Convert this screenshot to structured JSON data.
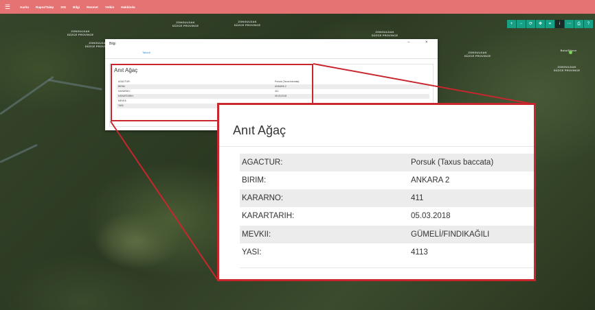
{
  "navbar": {
    "items": [
      "Harita",
      "Rapor/Talep",
      "SIG",
      "Bilgi",
      "Resmet",
      "Yetkin",
      "Hakkinda"
    ]
  },
  "map_tools": {
    "icons": [
      "plus-icon",
      "minus-icon",
      "refresh-icon",
      "crosshair-icon",
      "grid-icon",
      "info-icon",
      "ruler-icon",
      "print-icon",
      "help-icon"
    ],
    "glyphs": [
      "+",
      "−",
      "⟳",
      "✥",
      "⌗",
      "i",
      "⋯",
      "⎙",
      "?"
    ]
  },
  "map_labels": {
    "label1": "ZONGULDAK\nDÜZCE PROVINCE",
    "label2": "ZONGULDAK\nDÜZCE PROVINCE",
    "label3": "ZONGULDAK\nDÜZCE PROVINCE",
    "label4": "ZONGULDAK\nDÜZCE PROVINCE",
    "label5": "ZONGULDAK\nDÜZCE PROVINCE",
    "label6": "ZONGULDAK\nDÜZCE PROVINCE",
    "label7": "Bolu/Düzce",
    "label8": "ZONGULDAK\nDÜZCE PROVINCE"
  },
  "dialog": {
    "title": "Bilgi",
    "minimize": "−",
    "close": "×",
    "tab": "Tablo6",
    "card_title": "Anıt Ağaç",
    "rows": [
      {
        "k": "AGACTUR:",
        "v": "Porsuk (Taxus baccata)"
      },
      {
        "k": "BIRIM:",
        "v": "ANKARA 2"
      },
      {
        "k": "KARARNO:",
        "v": "411"
      },
      {
        "k": "KARARTARIH:",
        "v": "05.03.2018"
      },
      {
        "k": "MEVKII:",
        "v": ""
      },
      {
        "k": "YASI:",
        "v": ""
      }
    ]
  },
  "callout": {
    "title": "Anıt Ağaç",
    "rows": [
      {
        "k": "AGACTUR:",
        "v": "Porsuk (Taxus baccata)"
      },
      {
        "k": "BIRIM:",
        "v": "ANKARA 2"
      },
      {
        "k": "KARARNO:",
        "v": "411"
      },
      {
        "k": "KARARTARIH:",
        "v": "05.03.2018"
      },
      {
        "k": "MEVKII:",
        "v": "GÜMELİ/FINDIKAĞILI"
      },
      {
        "k": "YASI:",
        "v": "4113"
      }
    ]
  },
  "colors": {
    "navbar": "#e57373",
    "accent_teal": "#16a085",
    "highlight_red": "#c8262c"
  }
}
